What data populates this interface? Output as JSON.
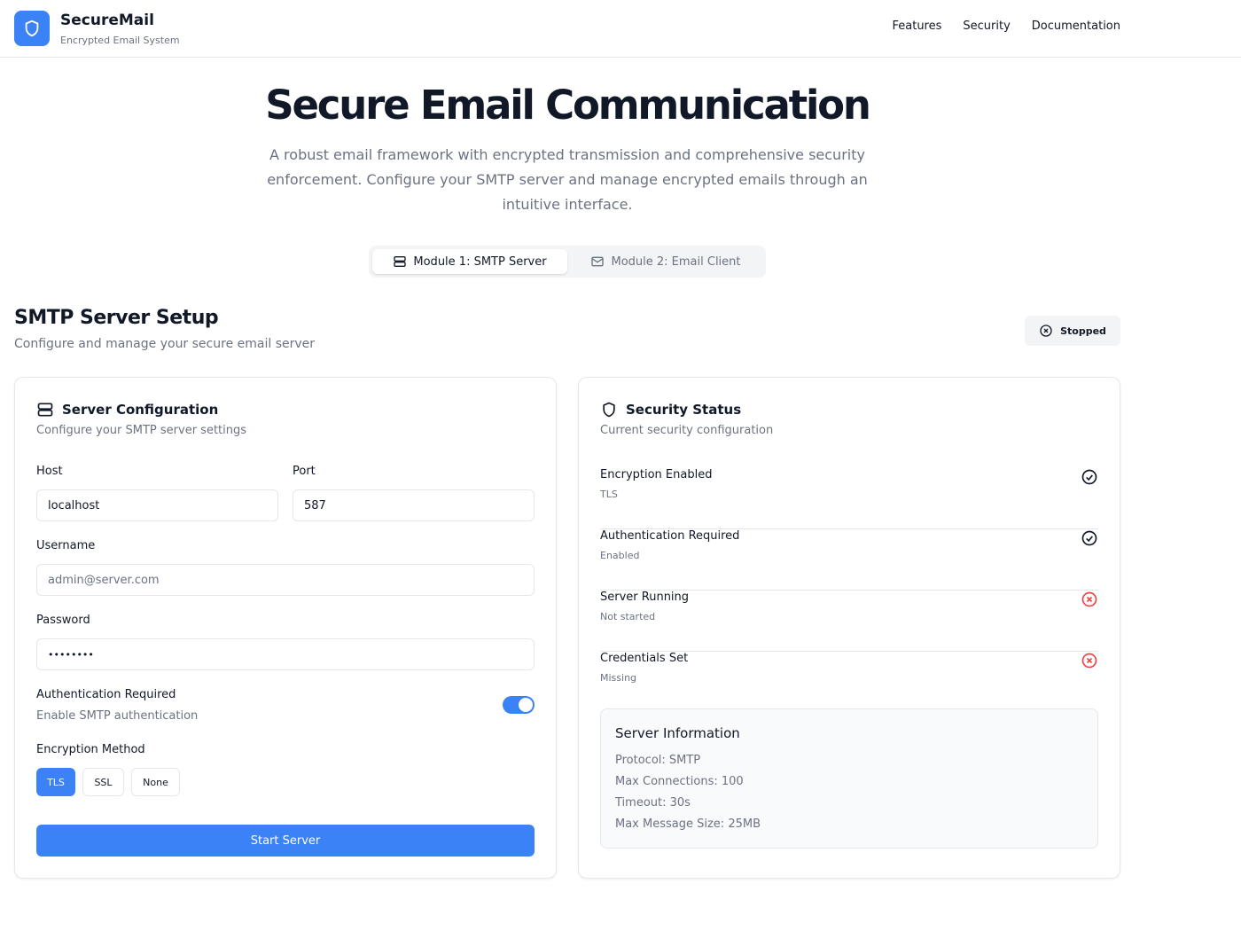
{
  "header": {
    "brand_name": "SecureMail",
    "brand_sub": "Encrypted Email System",
    "nav": [
      "Features",
      "Security",
      "Documentation"
    ]
  },
  "hero": {
    "title": "Secure Email Communication",
    "description": "A robust email framework with encrypted transmission and comprehensive security enforcement. Configure your SMTP server and manage encrypted emails through an intuitive interface."
  },
  "tabs": {
    "items": [
      {
        "label": "Module 1: SMTP Server",
        "active": true,
        "icon": "server-icon"
      },
      {
        "label": "Module 2: Email Client",
        "active": false,
        "icon": "mail-icon"
      }
    ]
  },
  "section": {
    "title": "SMTP Server Setup",
    "subtitle": "Configure and manage your secure email server",
    "status": "Stopped"
  },
  "config": {
    "title": "Server Configuration",
    "subtitle": "Configure your SMTP server settings",
    "host_label": "Host",
    "host_value": "localhost",
    "port_label": "Port",
    "port_value": "587",
    "username_label": "Username",
    "username_placeholder": "admin@server.com",
    "password_label": "Password",
    "password_value": "••••••••",
    "auth_label": "Authentication Required",
    "auth_sub": "Enable SMTP authentication",
    "auth_enabled": true,
    "encryption_label": "Encryption Method",
    "encryption_options": [
      "TLS",
      "SSL",
      "None"
    ],
    "encryption_selected": "TLS",
    "start_button": "Start Server"
  },
  "security": {
    "title": "Security Status",
    "subtitle": "Current security configuration",
    "items": [
      {
        "name": "Encryption Enabled",
        "value": "TLS",
        "ok": true
      },
      {
        "name": "Authentication Required",
        "value": "Enabled",
        "ok": true
      },
      {
        "name": "Server Running",
        "value": "Not started",
        "ok": false
      },
      {
        "name": "Credentials Set",
        "value": "Missing",
        "ok": false
      }
    ],
    "info": {
      "title": "Server Information",
      "lines": [
        "Protocol: SMTP",
        "Max Connections: 100",
        "Timeout: 30s",
        "Max Message Size: 25MB"
      ]
    }
  },
  "colors": {
    "accent": "#3b82f6",
    "ok": "#111827",
    "error": "#ef4444",
    "muted": "#6b7280"
  }
}
